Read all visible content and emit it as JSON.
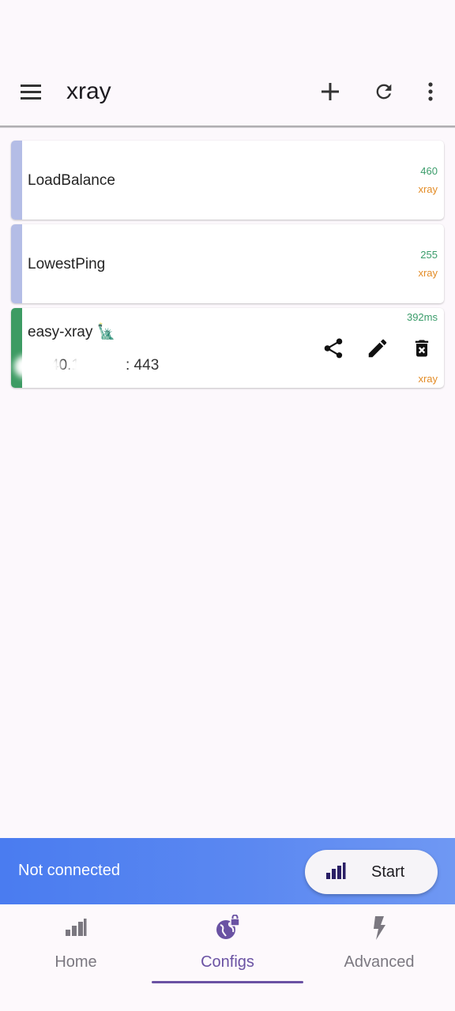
{
  "appbar": {
    "title": "xray",
    "menu_icon": "menu-icon",
    "add_icon": "plus-icon",
    "refresh_icon": "refresh-icon",
    "more_icon": "more-vert-icon"
  },
  "configs": [
    {
      "name": "LoadBalance",
      "ping": "460",
      "core": "xray",
      "strip_color": "#b4bde6"
    },
    {
      "name": "LowestPing",
      "ping": "255",
      "core": "xray",
      "strip_color": "#b4bde6"
    },
    {
      "name": "easy-xray 🗽",
      "ping": "392ms",
      "core": "xray",
      "address_prefix": "40.1",
      "address_port": ": 443",
      "strip_color": "#3d9b63",
      "actions": [
        "share-icon",
        "edit-icon",
        "delete-icon"
      ]
    }
  ],
  "connection": {
    "status": "Not connected",
    "start_label": "Start",
    "start_icon": "signal-bars-icon"
  },
  "bottom_nav": {
    "items": [
      {
        "label": "Home",
        "icon": "signal-bars-icon"
      },
      {
        "label": "Configs",
        "icon": "globe-lock-icon"
      },
      {
        "label": "Advanced",
        "icon": "lightning-icon"
      }
    ],
    "active_index": 1
  },
  "colors": {
    "accent": "#6a52a3",
    "ping": "#3a9c6a",
    "core": "#e38c26",
    "connection_bar": "#5b88f1"
  }
}
